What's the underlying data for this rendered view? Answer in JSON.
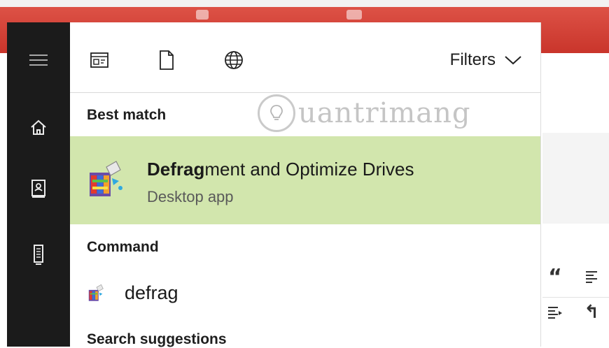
{
  "panel": {
    "filters_label": "Filters",
    "sections": {
      "best_match": "Best match",
      "command": "Command",
      "search_suggestions": "Search suggestions"
    },
    "best_match": {
      "title_bold": "Defrag",
      "title_rest": "ment and Optimize Drives",
      "subtitle": "Desktop app",
      "icon": "defrag-app-icon",
      "highlight_color": "#d2e6ad"
    },
    "command_item": {
      "label": "defrag",
      "icon": "defrag-app-icon"
    }
  },
  "rail": {
    "items": [
      "hamburger-menu-icon",
      "home-icon",
      "notebook-icon",
      "device-icon"
    ]
  },
  "background": {
    "toolbar_color": "#d5453a",
    "buttons": {
      "quote": "“",
      "undo": "↰"
    }
  },
  "watermark": {
    "text": "uantrimang"
  }
}
